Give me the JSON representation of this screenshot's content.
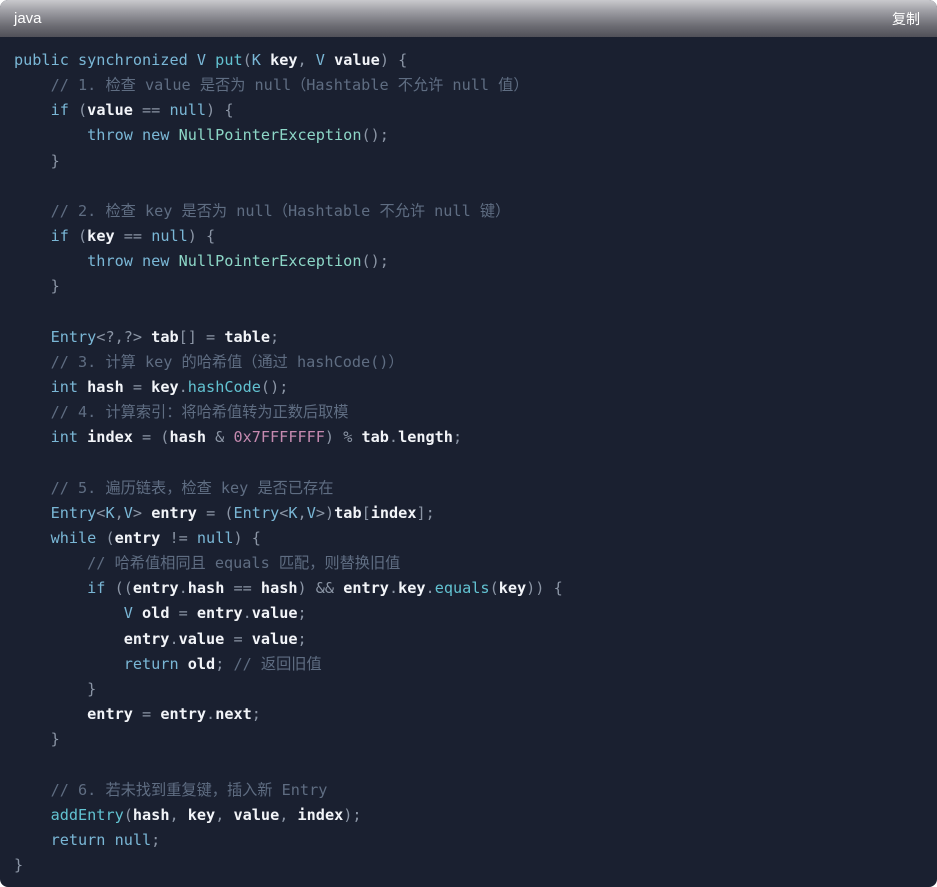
{
  "header": {
    "language": "java",
    "copy_label": "复制"
  },
  "code_lines": [
    [
      [
        "kw",
        "public synchronized V "
      ],
      [
        "fn",
        "put"
      ],
      [
        "pn",
        "("
      ],
      [
        "kw",
        "K "
      ],
      [
        "id",
        "key"
      ],
      [
        "pn",
        ", "
      ],
      [
        "kw",
        "V "
      ],
      [
        "id",
        "value"
      ],
      [
        "pn",
        ") {"
      ]
    ],
    [
      [
        "pn",
        "    "
      ],
      [
        "cm",
        "// 1. 检查 value 是否为 null（Hashtable 不允许 null 值）"
      ]
    ],
    [
      [
        "pn",
        "    "
      ],
      [
        "kw",
        "if "
      ],
      [
        "pn",
        "("
      ],
      [
        "id",
        "value"
      ],
      [
        "pn",
        " == "
      ],
      [
        "kw",
        "null"
      ],
      [
        "pn",
        ") {"
      ]
    ],
    [
      [
        "pn",
        "        "
      ],
      [
        "kw",
        "throw new "
      ],
      [
        "cls",
        "NullPointerException"
      ],
      [
        "pn",
        "();"
      ]
    ],
    [
      [
        "pn",
        "    }"
      ]
    ],
    [
      [
        "pn",
        ""
      ]
    ],
    [
      [
        "pn",
        "    "
      ],
      [
        "cm",
        "// 2. 检查 key 是否为 null（Hashtable 不允许 null 键）"
      ]
    ],
    [
      [
        "pn",
        "    "
      ],
      [
        "kw",
        "if "
      ],
      [
        "pn",
        "("
      ],
      [
        "id",
        "key"
      ],
      [
        "pn",
        " == "
      ],
      [
        "kw",
        "null"
      ],
      [
        "pn",
        ") {"
      ]
    ],
    [
      [
        "pn",
        "        "
      ],
      [
        "kw",
        "throw new "
      ],
      [
        "cls",
        "NullPointerException"
      ],
      [
        "pn",
        "();"
      ]
    ],
    [
      [
        "pn",
        "    }"
      ]
    ],
    [
      [
        "pn",
        ""
      ]
    ],
    [
      [
        "pn",
        "    "
      ],
      [
        "ty",
        "Entry"
      ],
      [
        "pn",
        "<?,?> "
      ],
      [
        "id",
        "tab"
      ],
      [
        "pn",
        "[] = "
      ],
      [
        "id",
        "table"
      ],
      [
        "pn",
        ";"
      ]
    ],
    [
      [
        "pn",
        "    "
      ],
      [
        "cm",
        "// 3. 计算 key 的哈希值（通过 hashCode()）"
      ]
    ],
    [
      [
        "pn",
        "    "
      ],
      [
        "kw",
        "int "
      ],
      [
        "id",
        "hash"
      ],
      [
        "pn",
        " = "
      ],
      [
        "id",
        "key"
      ],
      [
        "pn",
        "."
      ],
      [
        "fn",
        "hashCode"
      ],
      [
        "pn",
        "();"
      ]
    ],
    [
      [
        "pn",
        "    "
      ],
      [
        "cm",
        "// 4. 计算索引：将哈希值转为正数后取模"
      ]
    ],
    [
      [
        "pn",
        "    "
      ],
      [
        "kw",
        "int "
      ],
      [
        "id",
        "index"
      ],
      [
        "pn",
        " = ("
      ],
      [
        "id",
        "hash"
      ],
      [
        "pn",
        " & "
      ],
      [
        "num",
        "0x7FFFFFFF"
      ],
      [
        "pn",
        ") % "
      ],
      [
        "id",
        "tab"
      ],
      [
        "pn",
        "."
      ],
      [
        "id",
        "length"
      ],
      [
        "pn",
        ";"
      ]
    ],
    [
      [
        "pn",
        ""
      ]
    ],
    [
      [
        "pn",
        "    "
      ],
      [
        "cm",
        "// 5. 遍历链表，检查 key 是否已存在"
      ]
    ],
    [
      [
        "pn",
        "    "
      ],
      [
        "ty",
        "Entry"
      ],
      [
        "pn",
        "<"
      ],
      [
        "kw",
        "K"
      ],
      [
        "pn",
        ","
      ],
      [
        "kw",
        "V"
      ],
      [
        "pn",
        "> "
      ],
      [
        "id",
        "entry"
      ],
      [
        "pn",
        " = ("
      ],
      [
        "ty",
        "Entry"
      ],
      [
        "pn",
        "<"
      ],
      [
        "kw",
        "K"
      ],
      [
        "pn",
        ","
      ],
      [
        "kw",
        "V"
      ],
      [
        "pn",
        ">)"
      ],
      [
        "id",
        "tab"
      ],
      [
        "pn",
        "["
      ],
      [
        "id",
        "index"
      ],
      [
        "pn",
        "];"
      ]
    ],
    [
      [
        "pn",
        "    "
      ],
      [
        "kw",
        "while "
      ],
      [
        "pn",
        "("
      ],
      [
        "id",
        "entry"
      ],
      [
        "pn",
        " != "
      ],
      [
        "kw",
        "null"
      ],
      [
        "pn",
        ") {"
      ]
    ],
    [
      [
        "pn",
        "        "
      ],
      [
        "cm",
        "// 哈希值相同且 equals 匹配，则替换旧值"
      ]
    ],
    [
      [
        "pn",
        "        "
      ],
      [
        "kw",
        "if "
      ],
      [
        "pn",
        "(("
      ],
      [
        "id",
        "entry"
      ],
      [
        "pn",
        "."
      ],
      [
        "id",
        "hash"
      ],
      [
        "pn",
        " == "
      ],
      [
        "id",
        "hash"
      ],
      [
        "pn",
        ") && "
      ],
      [
        "id",
        "entry"
      ],
      [
        "pn",
        "."
      ],
      [
        "id",
        "key"
      ],
      [
        "pn",
        "."
      ],
      [
        "fn",
        "equals"
      ],
      [
        "pn",
        "("
      ],
      [
        "id",
        "key"
      ],
      [
        "pn",
        ")) {"
      ]
    ],
    [
      [
        "pn",
        "            "
      ],
      [
        "kw",
        "V "
      ],
      [
        "id",
        "old"
      ],
      [
        "pn",
        " = "
      ],
      [
        "id",
        "entry"
      ],
      [
        "pn",
        "."
      ],
      [
        "id",
        "value"
      ],
      [
        "pn",
        ";"
      ]
    ],
    [
      [
        "pn",
        "            "
      ],
      [
        "id",
        "entry"
      ],
      [
        "pn",
        "."
      ],
      [
        "id",
        "value"
      ],
      [
        "pn",
        " = "
      ],
      [
        "id",
        "value"
      ],
      [
        "pn",
        ";"
      ]
    ],
    [
      [
        "pn",
        "            "
      ],
      [
        "kw",
        "return "
      ],
      [
        "id",
        "old"
      ],
      [
        "pn",
        "; "
      ],
      [
        "cm",
        "// 返回旧值"
      ]
    ],
    [
      [
        "pn",
        "        }"
      ]
    ],
    [
      [
        "pn",
        "        "
      ],
      [
        "id",
        "entry"
      ],
      [
        "pn",
        " = "
      ],
      [
        "id",
        "entry"
      ],
      [
        "pn",
        "."
      ],
      [
        "id",
        "next"
      ],
      [
        "pn",
        ";"
      ]
    ],
    [
      [
        "pn",
        "    }"
      ]
    ],
    [
      [
        "pn",
        ""
      ]
    ],
    [
      [
        "pn",
        "    "
      ],
      [
        "cm",
        "// 6. 若未找到重复键，插入新 Entry"
      ]
    ],
    [
      [
        "pn",
        "    "
      ],
      [
        "fn",
        "addEntry"
      ],
      [
        "pn",
        "("
      ],
      [
        "id",
        "hash"
      ],
      [
        "pn",
        ", "
      ],
      [
        "id",
        "key"
      ],
      [
        "pn",
        ", "
      ],
      [
        "id",
        "value"
      ],
      [
        "pn",
        ", "
      ],
      [
        "id",
        "index"
      ],
      [
        "pn",
        ");"
      ]
    ],
    [
      [
        "pn",
        "    "
      ],
      [
        "kw",
        "return null"
      ],
      [
        "pn",
        ";"
      ]
    ],
    [
      [
        "pn",
        "}"
      ]
    ]
  ]
}
